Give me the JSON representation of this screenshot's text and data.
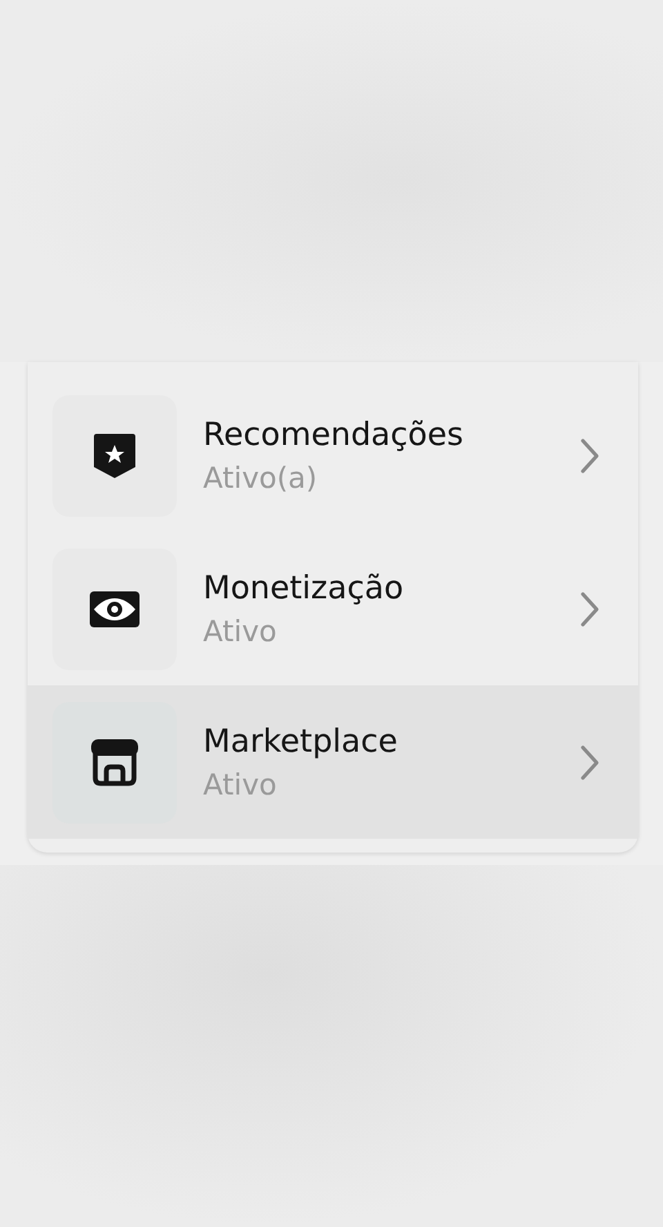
{
  "items": [
    {
      "kind": "badge",
      "title": "Recomendações",
      "status": "Ativo(a)",
      "selected": false
    },
    {
      "kind": "money",
      "title": "Monetização",
      "status": "Ativo",
      "selected": false
    },
    {
      "kind": "store",
      "title": "Marketplace",
      "status": "Ativo",
      "selected": true
    }
  ]
}
